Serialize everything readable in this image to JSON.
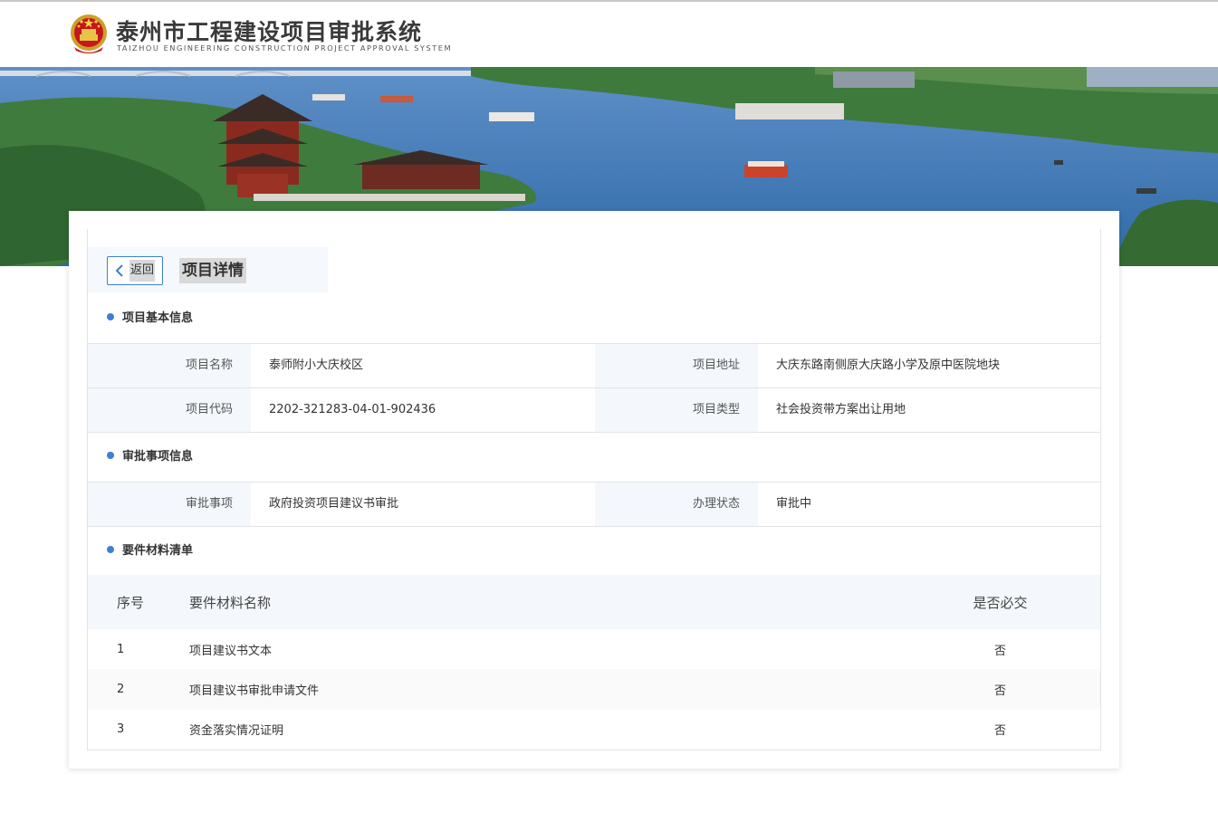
{
  "header": {
    "title": "泰州市工程建设项目审批系统",
    "subtitle": "TAIZHOU ENGINEERING CONSTRUCTION PROJECT APPROVAL SYSTEM",
    "emblem_icon": "national-emblem-icon"
  },
  "colors": {
    "accent": "#3d7fd6",
    "label_bg": "#f4f8fd",
    "border": "#e3e3e3"
  },
  "page": {
    "back_label": "返回",
    "title": "项目详情"
  },
  "basic_info": {
    "section_title": "项目基本信息",
    "rows": [
      [
        {
          "label": "项目名称",
          "value": "泰师附小大庆校区"
        },
        {
          "label": "项目地址",
          "value": "大庆东路南侧原大庆路小学及原中医院地块"
        }
      ],
      [
        {
          "label": "项目代码",
          "value": "2202-321283-04-01-902436"
        },
        {
          "label": "项目类型",
          "value": "社会投资带方案出让用地"
        }
      ]
    ]
  },
  "approval_info": {
    "section_title": "审批事项信息",
    "item_label": "审批事项",
    "item_value": "政府投资项目建议书审批",
    "status_label": "办理状态",
    "status_value": "审批中"
  },
  "materials": {
    "section_title": "要件材料清单",
    "columns": [
      "序号",
      "要件材料名称",
      "是否必交"
    ],
    "rows": [
      {
        "index": "1",
        "name": "项目建议书文本",
        "required": "否"
      },
      {
        "index": "2",
        "name": "项目建议书审批申请文件",
        "required": "否"
      },
      {
        "index": "3",
        "name": "资金落实情况证明",
        "required": "否"
      }
    ]
  }
}
